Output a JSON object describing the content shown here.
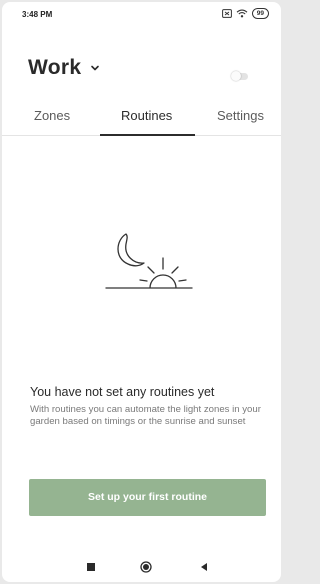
{
  "status_bar": {
    "time": "3:48 PM",
    "battery": "99",
    "icons": [
      "sim-icon",
      "wifi-icon",
      "battery-icon"
    ]
  },
  "header": {
    "location": "Work",
    "location_icon": "chevron-down-icon",
    "power_toggle": "off"
  },
  "tabs": [
    {
      "label": "Zones",
      "active": false
    },
    {
      "label": "Routines",
      "active": true
    },
    {
      "label": "Settings",
      "active": false
    }
  ],
  "empty_state": {
    "illustration": "moon-and-sunrise-icon",
    "title": "You have not set any routines yet",
    "description": "With routines you can automate the light zones in your garden based on timings or the sunrise and sunset",
    "cta_label": "Set up your first routine"
  },
  "nav_bar": {
    "icons": [
      "recents-square-icon",
      "home-circle-icon",
      "back-triangle-icon"
    ]
  },
  "colors": {
    "accent": "#95b491",
    "text": "#2a2a2a",
    "muted_text": "#7a7a7a"
  }
}
